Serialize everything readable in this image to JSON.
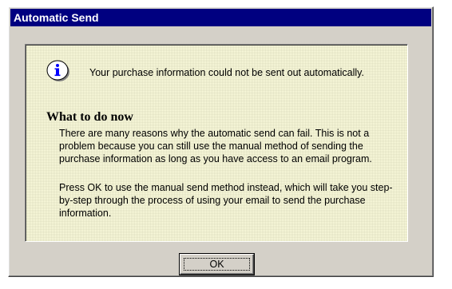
{
  "window": {
    "title": "Automatic Send",
    "title_bar_color": "#000080",
    "panel_color": "#ffffe0",
    "face_color": "#d4d0c8"
  },
  "dialog": {
    "icon": "info-icon",
    "message": "Your purchase information could not be sent out automatically.",
    "heading": "What to do now",
    "paragraphs": [
      "There are many reasons why the automatic send can fail. This is not a problem because you can still use the manual method of sending the purchase information as long as you have access to an email program.",
      "Press OK to use the manual send method instead, which will take you step-by-step through the process of using your email to send the purchase information."
    ]
  },
  "buttons": {
    "ok_label": "OK"
  }
}
